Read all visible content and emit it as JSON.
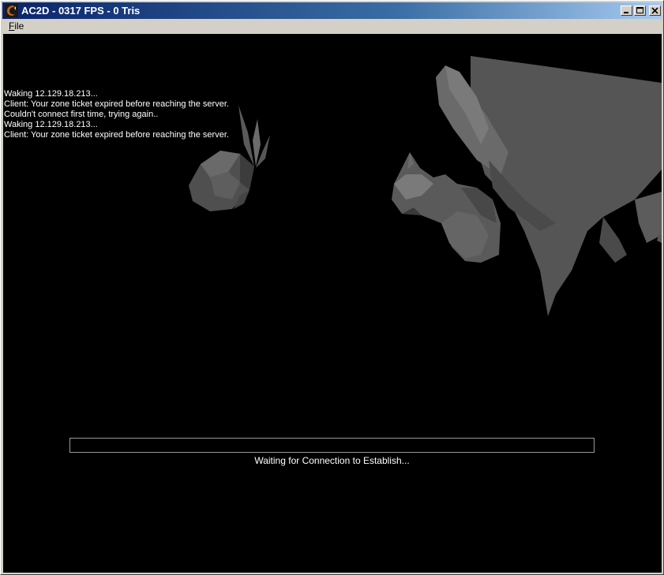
{
  "window": {
    "title": "AC2D - 0317 FPS - 0 Tris"
  },
  "menu": {
    "file_label_ul": "F",
    "file_label_rest": "ile"
  },
  "console": {
    "lines": [
      "Waking 12.129.18.213...",
      "Client: Your zone ticket expired before reaching the server.",
      "Couldn't connect first time, trying again..",
      "Waking 12.129.18.213...",
      "Client: Your zone ticket expired before reaching the server."
    ]
  },
  "status": {
    "message": "Waiting for Connection to Establish...",
    "progress_fraction": 0
  },
  "colors": {
    "titlebar_start": "#0a246a",
    "titlebar_end": "#a6caf0",
    "viewport_bg": "#000000",
    "model_gray": "#5a5a5a"
  }
}
